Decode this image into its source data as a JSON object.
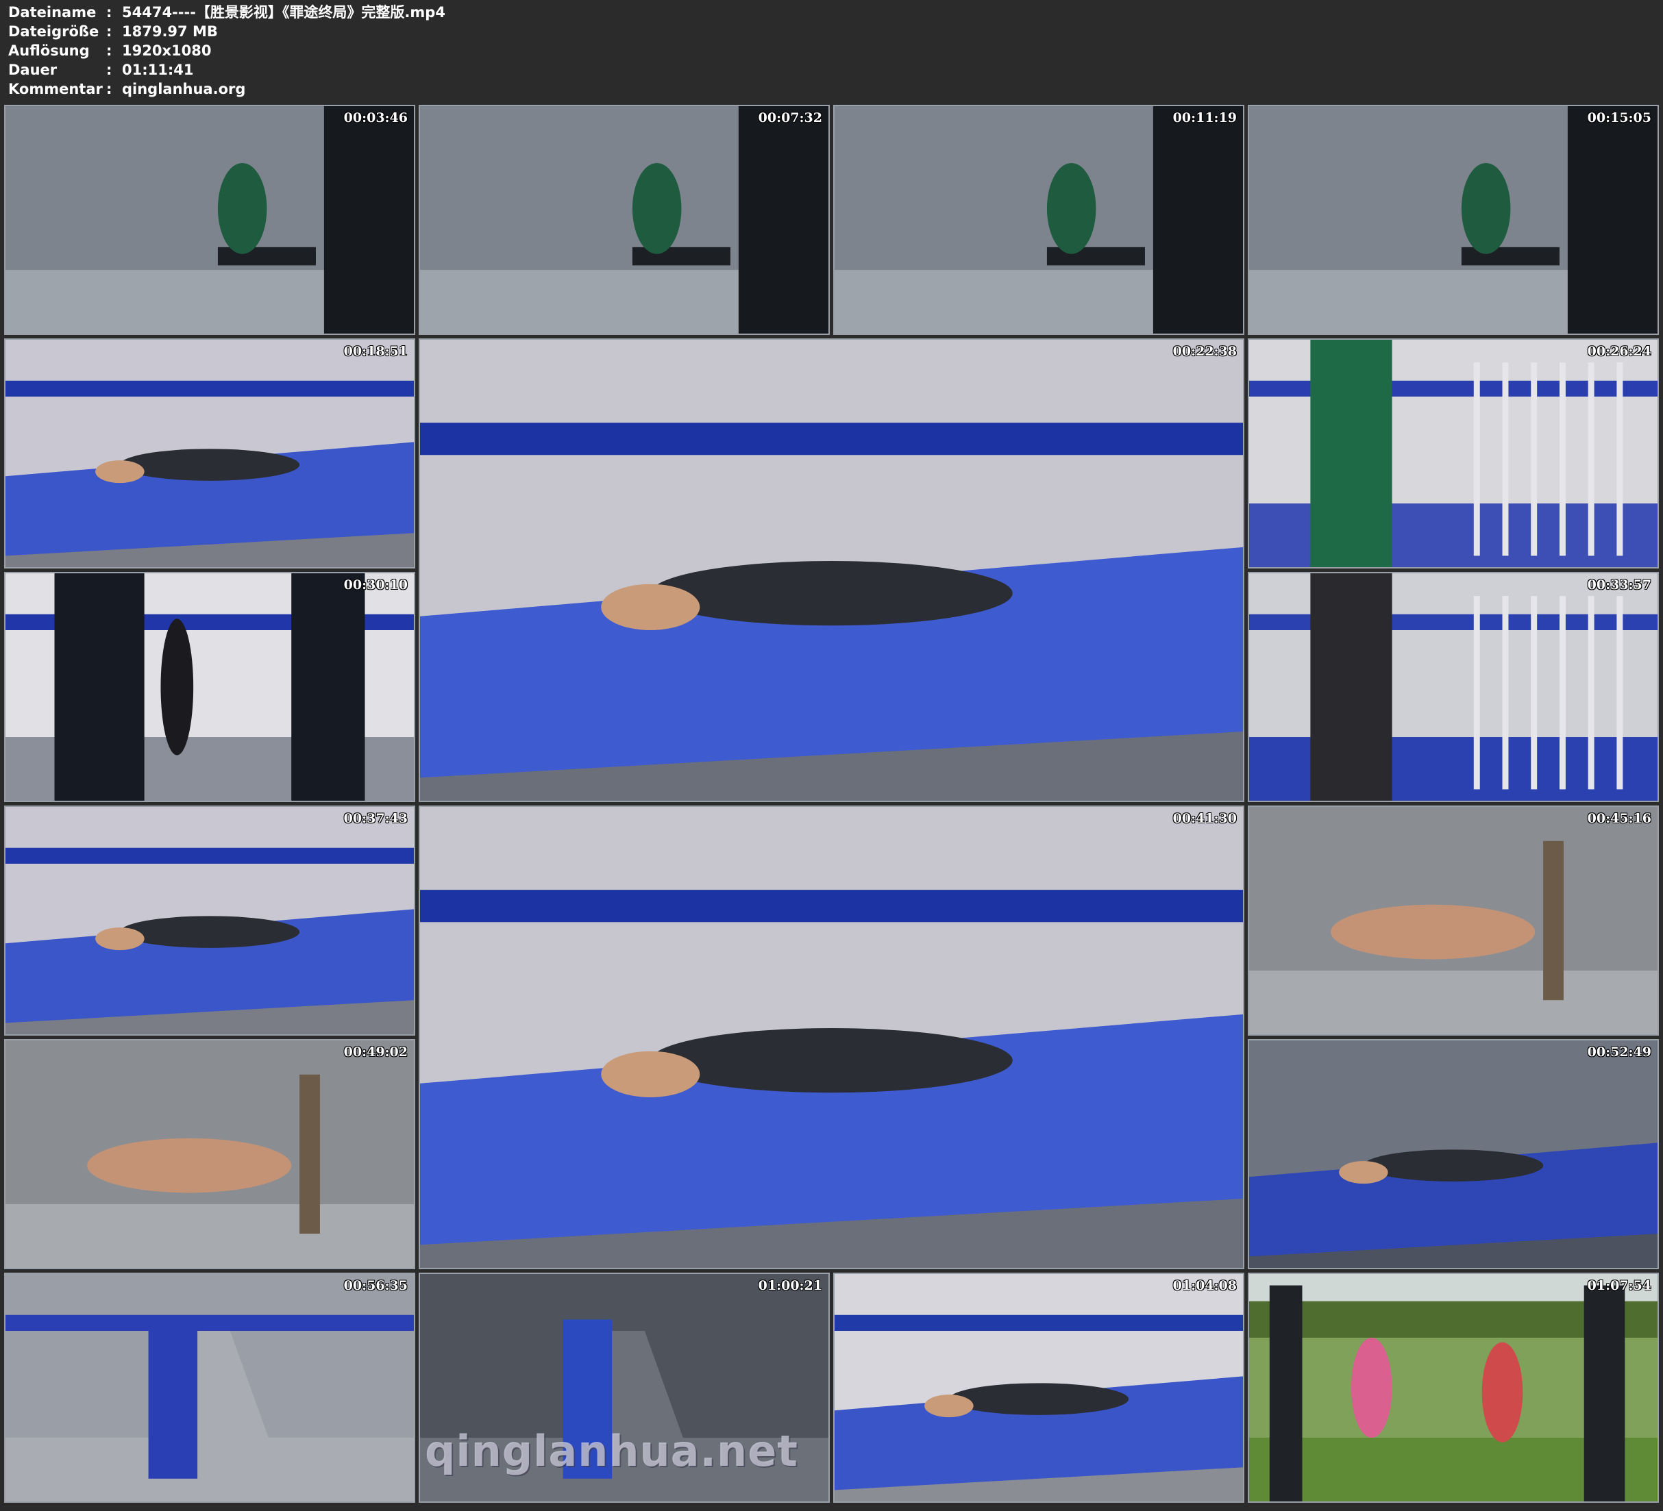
{
  "meta": {
    "rows": [
      {
        "key": "Dateiname",
        "sep": ":",
        "value": "54474----【胜景影视】《罪途终局》完整版.mp4"
      },
      {
        "key": "Dateigröße",
        "sep": ":",
        "value": "1879.97 MB"
      },
      {
        "key": "Auflösung",
        "sep": ":",
        "value": "1920x1080"
      },
      {
        "key": "Dauer",
        "sep": ":",
        "value": "01:11:41"
      },
      {
        "key": "Kommentar",
        "sep": ":",
        "value": "qinglanhua.org"
      }
    ]
  },
  "thumbnails": [
    {
      "time": "00:03:46",
      "scene": "cell-wall"
    },
    {
      "time": "00:07:32",
      "scene": "cell-wall"
    },
    {
      "time": "00:11:19",
      "scene": "cell-wall"
    },
    {
      "time": "00:15:05",
      "scene": "cell-wall"
    },
    {
      "time": "00:18:51",
      "scene": "bed"
    },
    {
      "time": "00:22:38",
      "scene": "bed-large"
    },
    {
      "time": "00:26:24",
      "scene": "room-blue"
    },
    {
      "time": "00:30:10",
      "scene": "doorway"
    },
    {
      "time": "00:33:57",
      "scene": "bars"
    },
    {
      "time": "00:37:43",
      "scene": "bed"
    },
    {
      "time": "00:41:30",
      "scene": "bed-large"
    },
    {
      "time": "00:45:16",
      "scene": "floor"
    },
    {
      "time": "00:49:02",
      "scene": "floor"
    },
    {
      "time": "00:52:49",
      "scene": "cell-bed"
    },
    {
      "time": "00:56:35",
      "scene": "corridor"
    },
    {
      "time": "01:00:21",
      "scene": "corridor-dark"
    },
    {
      "time": "01:04:08",
      "scene": "bunk"
    },
    {
      "time": "01:07:54",
      "scene": "grass"
    }
  ],
  "watermark": "qinglanhua.net"
}
